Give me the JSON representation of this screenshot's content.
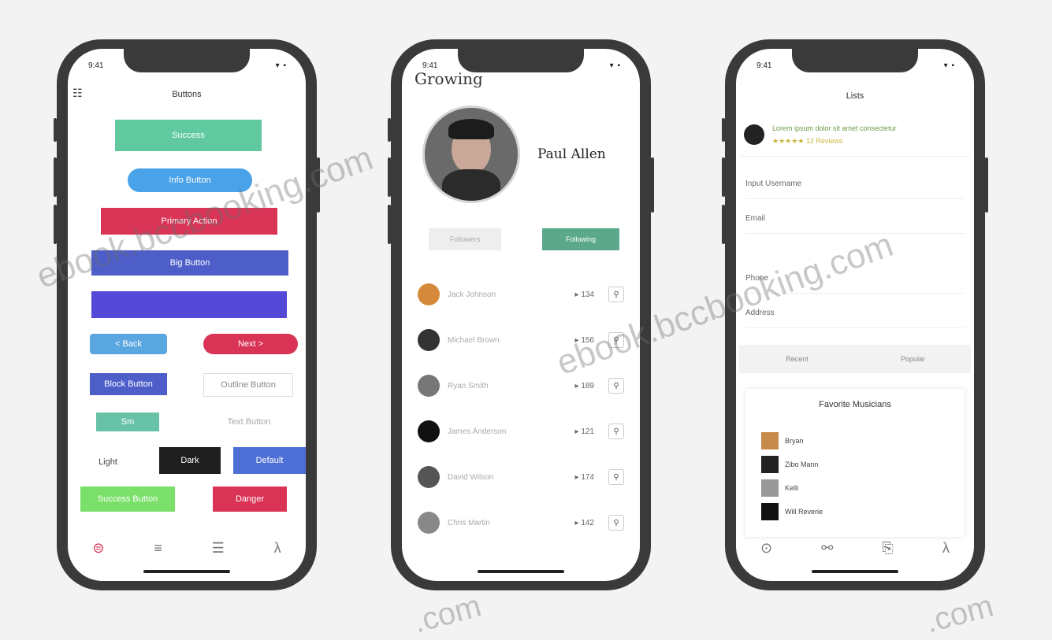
{
  "phone1": {
    "time": "9:41",
    "status_icons": "▾ ▪",
    "title": "Buttons",
    "menu_glyph": "☷",
    "buttons": [
      "Success",
      "Info Button",
      "Primary Action",
      "Big Button",
      "",
      "< Back",
      "Next >",
      "Block Button",
      "Outline Button",
      "Sm",
      "Text Button",
      "Light",
      "Dark",
      "Default",
      "Success Button",
      "Danger"
    ],
    "tabs": [
      "⊜",
      "≡",
      "☰",
      "λ"
    ]
  },
  "phone2": {
    "time": "9:41",
    "status_icons": "▾ ▪",
    "title": "Growing",
    "profile_name": "Paul Allen",
    "follow_left": "Followers",
    "follow_right": "Following",
    "rows": [
      {
        "name": "Jack Johnson",
        "count": "▸ 134",
        "icon": "⚲"
      },
      {
        "name": "Michael Brown",
        "count": "▸ 156",
        "icon": "⚲"
      },
      {
        "name": "Ryan Smith",
        "count": "▸ 189",
        "icon": "⚲"
      },
      {
        "name": "James Anderson",
        "count": "▸ 121",
        "icon": "⚲"
      },
      {
        "name": "David Wilson",
        "count": "▸ 174",
        "icon": "⚲"
      },
      {
        "name": "Chris Martin",
        "count": "▸ 142",
        "icon": "⚲"
      }
    ]
  },
  "phone3": {
    "time": "9:41",
    "status_icons": "▾ ▪",
    "title": "Lists",
    "user_info": "Lorem ipsum dolor sit amet consectetur",
    "user_sub": "★★★★★   12 Reviews",
    "fields": [
      "Input Username",
      "Email",
      "Phone",
      "Address"
    ],
    "tabs_row": [
      "Recent",
      "Popular"
    ],
    "favorites_title": "Favorite Musicians",
    "favorites": [
      "Bryan",
      "Zibo Mann",
      "Kelli",
      "Will Reverie"
    ],
    "tab_bar": [
      "⊙",
      "⚯",
      "⎘",
      "λ"
    ]
  },
  "watermark": {
    "text1": "ebook.bccbooking.com",
    "text2": "ebook.bccbooking.com",
    "text3": ".com",
    "text4": ".com"
  }
}
